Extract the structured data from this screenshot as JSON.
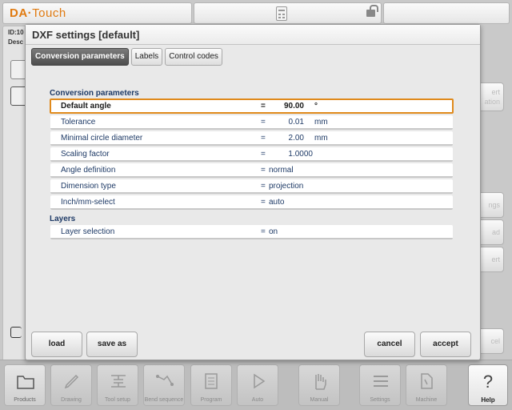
{
  "app": {
    "logo_da": "DA",
    "logo_touch": "Touch",
    "left_strip_line1": "ID:10",
    "left_strip_line2": "Desc"
  },
  "right_side": {
    "btn1": "ert\nation",
    "btn2": "ngs",
    "btn3": "ad",
    "btn4": "ert",
    "btn5": "cel"
  },
  "dialog": {
    "title": "DXF settings [default]",
    "tabs": [
      {
        "label": "Conversion parameters",
        "active": true
      },
      {
        "label": "Labels",
        "active": false
      },
      {
        "label": "Control codes",
        "active": false
      }
    ],
    "sections": {
      "conversion": "Conversion parameters",
      "layers": "Layers"
    },
    "params": [
      {
        "label": "Default angle",
        "eq": "=",
        "value": "90.00",
        "unit": "°"
      },
      {
        "label": "Tolerance",
        "eq": "=",
        "value": "0.01",
        "unit": "mm"
      },
      {
        "label": "Minimal circle diameter",
        "eq": "=",
        "value": "2.00",
        "unit": "mm"
      },
      {
        "label": "Scaling factor",
        "eq": "=",
        "value": "1.0000",
        "unit": ""
      },
      {
        "label": "Angle definition",
        "eq": "=",
        "value": "normal",
        "unit": ""
      },
      {
        "label": "Dimension type",
        "eq": "=",
        "value": "projection",
        "unit": ""
      },
      {
        "label": "Inch/mm-select",
        "eq": "=",
        "value": "auto",
        "unit": ""
      }
    ],
    "layers": [
      {
        "label": "Layer selection",
        "eq": "=",
        "value": "on"
      }
    ],
    "buttons": {
      "load": "load",
      "save_as": "save as",
      "cancel": "cancel",
      "accept": "accept"
    }
  },
  "bottom_nav": [
    {
      "label": "Products",
      "icon": "folder-icon"
    },
    {
      "label": "Drawing",
      "icon": "pencil-icon"
    },
    {
      "label": "Tool setup",
      "icon": "tool-icon"
    },
    {
      "label": "Bend sequence",
      "icon": "bend-icon"
    },
    {
      "label": "Program",
      "icon": "program-icon"
    },
    {
      "label": "Auto",
      "icon": "play-icon"
    },
    {
      "label": "Manual",
      "icon": "hand-icon"
    },
    {
      "label": "Settings",
      "icon": "settings-icon"
    },
    {
      "label": "Machine",
      "icon": "machine-icon"
    },
    {
      "label": "Help",
      "icon": "help-icon"
    }
  ],
  "colors": {
    "accent_orange": "#e07a10",
    "label_blue": "#1e3a66",
    "selected_border": "#e08a1c",
    "active_tab": "#5a5a5a"
  }
}
